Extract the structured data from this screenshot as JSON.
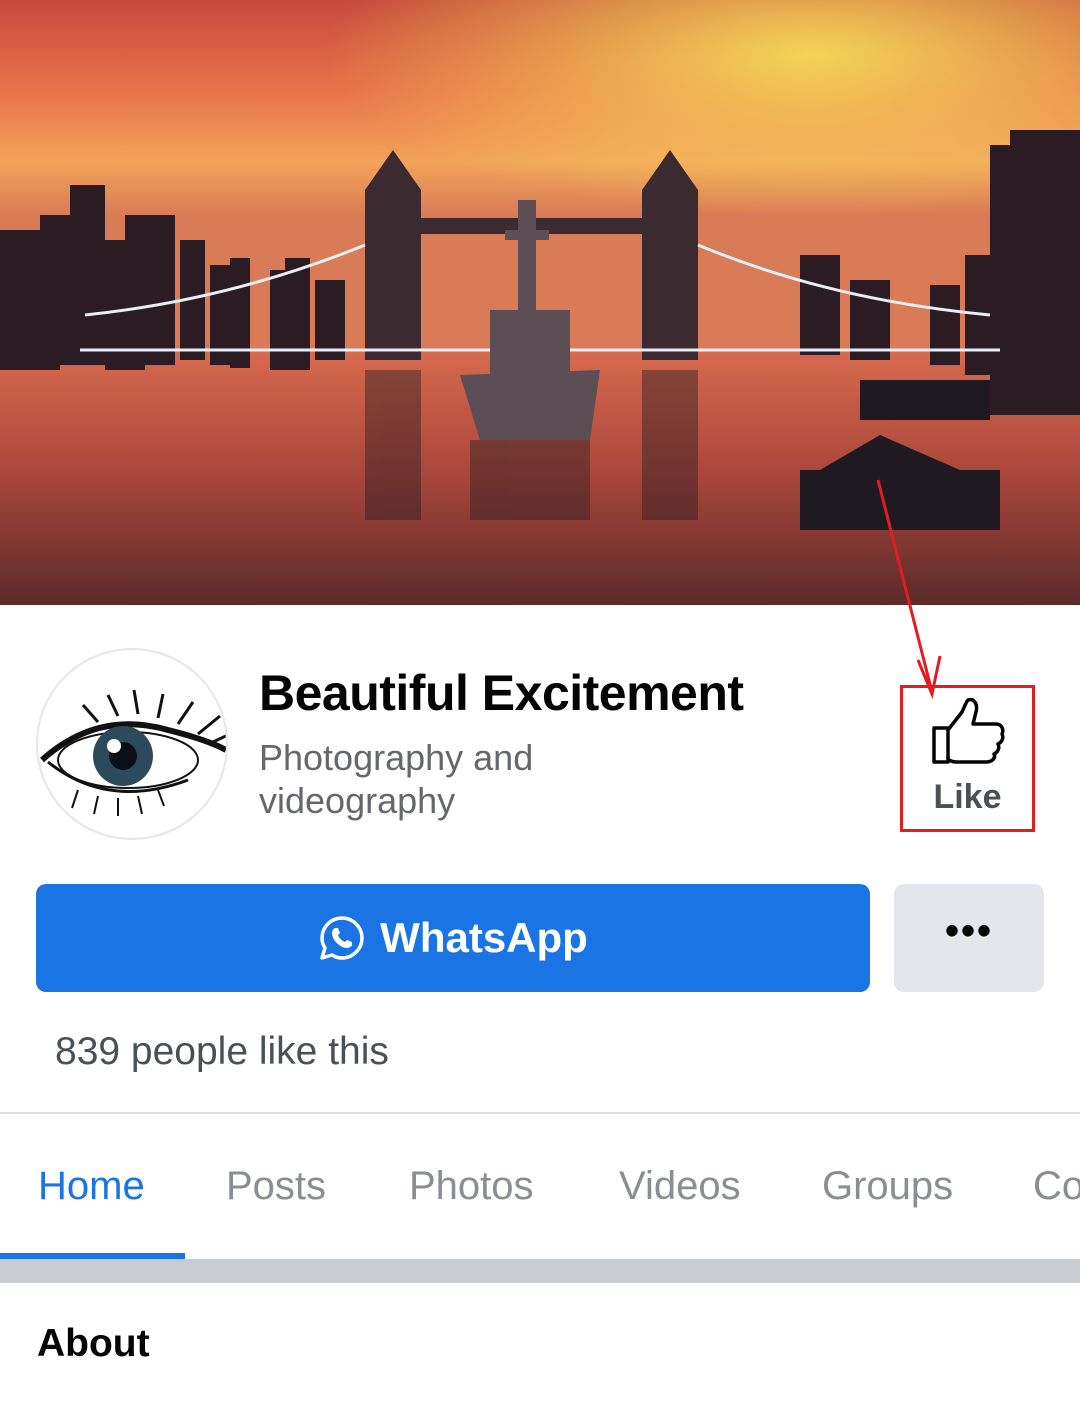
{
  "cover": {
    "description_icon": "tower-bridge-sunset-photo"
  },
  "profile": {
    "avatar_icon": "eye-icon",
    "name": "Beautiful Excitement",
    "category": "Photography and videography"
  },
  "like_button": {
    "label": "Like",
    "icon": "thumbs-up-icon",
    "highlight_color": "#e31b23"
  },
  "actions": {
    "whatsapp_label": "WhatsApp",
    "whatsapp_icon": "whatsapp-icon",
    "more_label": "•••",
    "primary_color": "#1b74e4"
  },
  "likes_text": "839 people like this",
  "tabs": [
    {
      "label": "Home",
      "active": true
    },
    {
      "label": "Posts",
      "active": false
    },
    {
      "label": "Photos",
      "active": false
    },
    {
      "label": "Videos",
      "active": false
    },
    {
      "label": "Groups",
      "active": false
    },
    {
      "label": "Co",
      "active": false
    }
  ],
  "about": {
    "heading": "About"
  }
}
